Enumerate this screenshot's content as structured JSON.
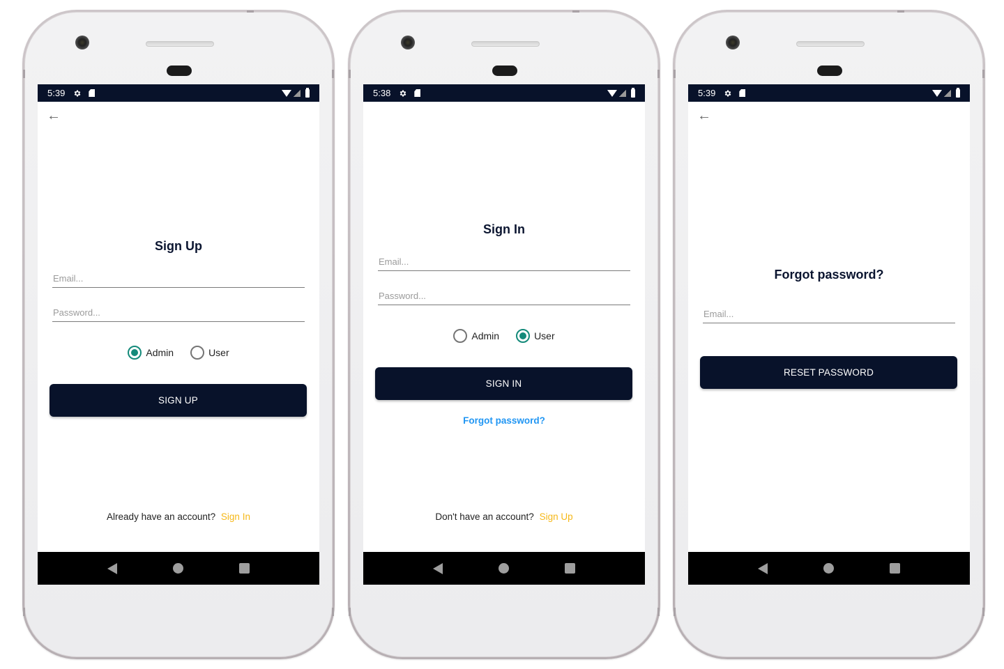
{
  "screens": [
    {
      "id": "sign-up",
      "status_time": "5:39",
      "title": "Sign Up",
      "email_placeholder": "Email...",
      "password_placeholder": "Password...",
      "radio_admin": "Admin",
      "radio_user": "User",
      "selected_role": "Admin",
      "button_label": "SIGN UP",
      "footer_text": "Already have an account?",
      "footer_link": "Sign In"
    },
    {
      "id": "sign-in",
      "status_time": "5:38",
      "title": "Sign In",
      "email_placeholder": "Email...",
      "password_placeholder": "Password...",
      "radio_admin": "Admin",
      "radio_user": "User",
      "selected_role": "User",
      "button_label": "SIGN IN",
      "forgot_link": "Forgot password?",
      "footer_text": "Don't have an account?",
      "footer_link": "Sign Up"
    },
    {
      "id": "forgot-password",
      "status_time": "5:39",
      "title": "Forgot password?",
      "email_placeholder": "Email...",
      "button_label": "RESET PASSWORD"
    }
  ],
  "status_icons": [
    "gear-icon",
    "sd-card-icon",
    "wifi-icon",
    "signal-icon",
    "battery-icon"
  ],
  "nav_icons": [
    "back-triangle-icon",
    "home-circle-icon",
    "recents-square-icon"
  ],
  "colors": {
    "primary": "#08122a",
    "radio_accent": "#148a7a",
    "link_blue": "#2196f3",
    "link_yellow": "#f6b818"
  }
}
